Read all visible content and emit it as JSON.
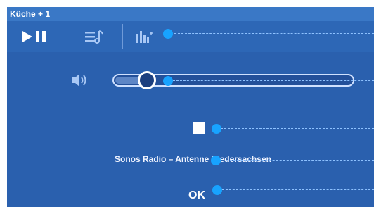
{
  "window": {
    "title": "Küche + 1"
  },
  "toolbar": {
    "play_pause_icon": "play-pause-icon",
    "queue_icon": "queue-icon",
    "equalizer_icon": "equalizer-icon"
  },
  "volume": {
    "icon": "speaker-volume-icon",
    "level": 0.14
  },
  "playback": {
    "stop_icon": "stop-icon"
  },
  "now_playing": {
    "text": "Sonos Radio –  Antenne Niedersachsen"
  },
  "footer": {
    "ok_label": "OK"
  },
  "colors": {
    "panel": "#2a60ae",
    "titlebar": "#3a78c6",
    "callout": "#18a3ff"
  }
}
